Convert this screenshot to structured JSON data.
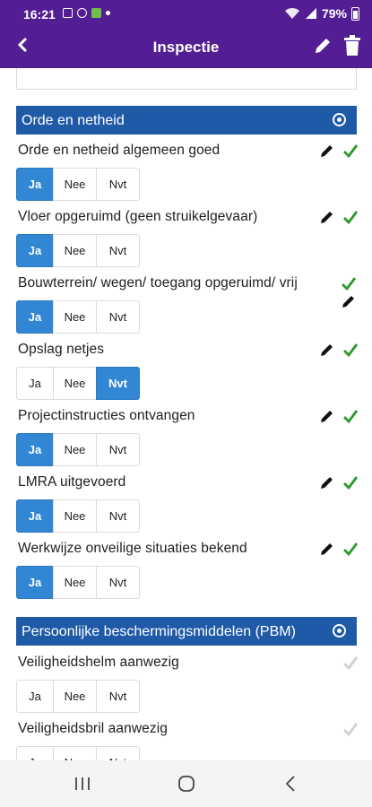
{
  "status_bar": {
    "time": "16:21",
    "battery": "79%"
  },
  "app_bar": {
    "title": "Inspectie"
  },
  "colors": {
    "primary": "#531d94",
    "section": "#1f5aa7",
    "selected": "#3287d4",
    "check": "#2a9a2a"
  },
  "sections": [
    {
      "title": "Orde en netheid",
      "questions": [
        {
          "label": "Orde en netheid algemeen goed",
          "selected": "Ja"
        },
        {
          "label": "Vloer opgeruimd (geen struikelgevaar)",
          "selected": "Ja"
        },
        {
          "label": "Bouwterrein/ wegen/ toegang opgeruimd/ vrij",
          "selected": "Ja"
        },
        {
          "label": "Opslag netjes",
          "selected": "Nvt"
        },
        {
          "label": "Projectinstructies ontvangen",
          "selected": "Ja"
        },
        {
          "label": "LMRA uitgevoerd",
          "selected": "Ja"
        },
        {
          "label": "Werkwijze onveilige situaties bekend",
          "selected": "Ja"
        }
      ]
    },
    {
      "title": "Persoonlijke beschermingsmiddelen (PBM)",
      "questions": [
        {
          "label": "Veiligheidshelm aanwezig",
          "selected": ""
        },
        {
          "label": "Veiligheidsbril aanwezig",
          "selected": ""
        }
      ]
    }
  ],
  "options": {
    "ja": "Ja",
    "nee": "Nee",
    "nvt": "Nvt"
  }
}
